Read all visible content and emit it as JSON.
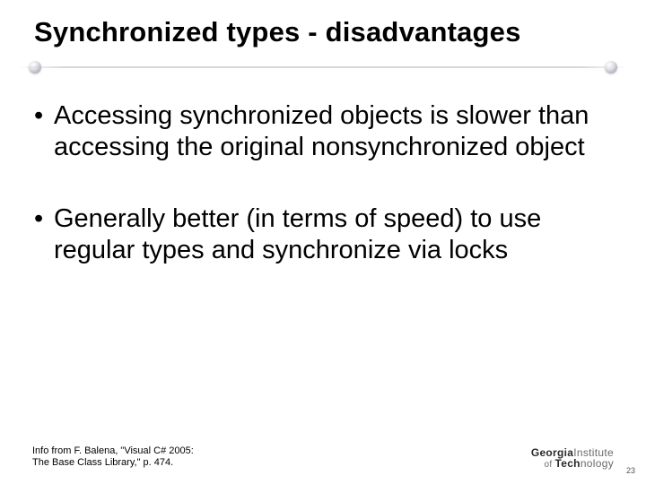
{
  "title": "Synchronized types - disadvantages",
  "bullets": [
    "Accessing synchronized objects is slower than accessing the original nonsynchronized object",
    "Generally better (in terms of speed) to use regular types and synchronize via locks"
  ],
  "citation": {
    "line1": "Info from F. Balena, \"Visual C# 2005:",
    "line2": "The Base Class Library,\" p. 474."
  },
  "logo": {
    "line1_strong": "Georgia",
    "line1_light": "Institute",
    "line2_of": "of ",
    "line2_strong": "Tech",
    "line2_light": "nology"
  },
  "page_number": "23"
}
